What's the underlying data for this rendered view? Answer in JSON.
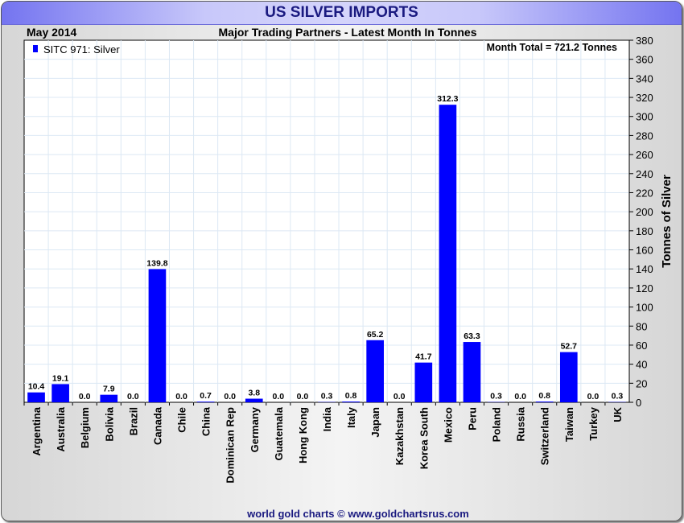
{
  "header": {
    "title": "US SILVER IMPORTS",
    "date": "May 2014",
    "subtitle": "Major Trading Partners - Latest Month In Tonnes"
  },
  "footer": {
    "credit": "world gold charts © www.goldchartsrus.com"
  },
  "colors": {
    "bar": "#0000ff",
    "title": "#1a1a80",
    "grid": "#dce8f4"
  },
  "chart_data": {
    "type": "bar",
    "title": "Major Trading Partners - Latest Month In Tonnes",
    "legend": {
      "label": "SITC 971: Silver",
      "placement": "top-left"
    },
    "annotation": "Month Total = 721.2 Tonnes",
    "ylabel": "Tonnes of Silver",
    "xlabel": "",
    "ylim": [
      0,
      380
    ],
    "ytick_step": 20,
    "grid": true,
    "categories": [
      "Argentina",
      "Australia",
      "Belgium",
      "Bolivia",
      "Brazil",
      "Canada",
      "Chile",
      "China",
      "Dominican Rep",
      "Germany",
      "Guatemala",
      "Hong Kong",
      "India",
      "Italy",
      "Japan",
      "Kazakhstan",
      "Korea South",
      "Mexico",
      "Peru",
      "Poland",
      "Russia",
      "Switzerland",
      "Taiwan",
      "Turkey",
      "UK"
    ],
    "values": [
      10.4,
      19.1,
      0.0,
      7.9,
      0.0,
      139.8,
      0.0,
      0.7,
      0.0,
      3.8,
      0.0,
      0.0,
      0.3,
      0.8,
      65.2,
      0.0,
      41.7,
      312.3,
      63.3,
      0.3,
      0.0,
      0.8,
      52.7,
      0.0,
      0.3
    ]
  }
}
